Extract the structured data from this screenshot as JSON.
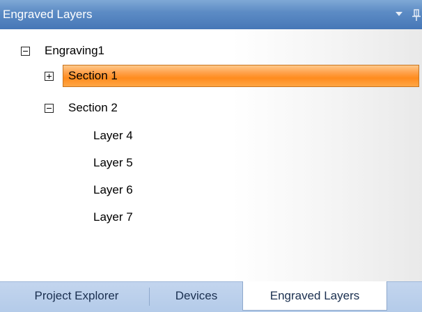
{
  "panel": {
    "title": "Engraved Layers",
    "dropdown_icon": "dropdown-arrow-icon",
    "pin_icon": "pin-icon"
  },
  "tree": {
    "root": {
      "label": "Engraving1",
      "expanded": true
    },
    "section1": {
      "label": "Section 1",
      "expanded": false,
      "selected": true
    },
    "section2": {
      "label": "Section 2",
      "expanded": true
    },
    "layers": [
      "Layer 4",
      "Layer 5",
      "Layer 6",
      "Layer 7"
    ]
  },
  "tabs": [
    {
      "label": "Project Explorer",
      "active": false
    },
    {
      "label": "Devices",
      "active": false
    },
    {
      "label": "Engraved Layers",
      "active": true
    }
  ],
  "colors": {
    "titlebar": "#5d8cc5",
    "selection": "#ff9a3a",
    "tabstrip": "#b9cfeb"
  }
}
